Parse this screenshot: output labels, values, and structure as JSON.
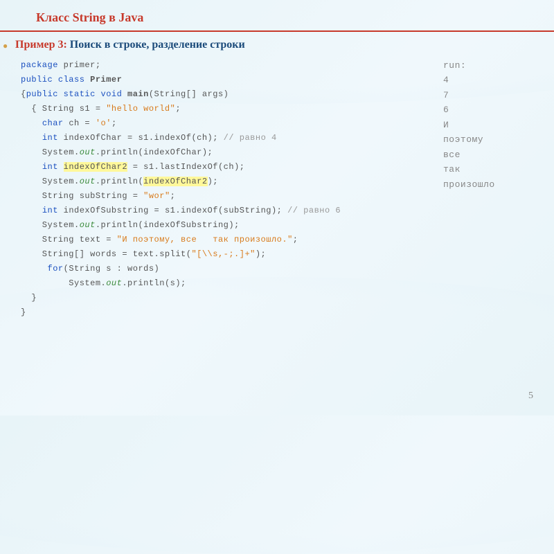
{
  "title": "Класс  String в Java",
  "subtitle_ex": "Пример 3:",
  "subtitle_desc": " Поиск в строке, разделение строки",
  "code": {
    "l1_a": "package",
    "l1_b": " primer;",
    "l2_a": "public class ",
    "l2_b": "Primer",
    "l3_a": "{",
    "l3_b": "public static void ",
    "l3_c": "main",
    "l3_d": "(String[] args)",
    "l4_a": "  { String s1 = ",
    "l4_b": "\"hello world\"",
    "l4_c": ";",
    "l5_a": "    ",
    "l5_b": "char",
    "l5_c": " ch = ",
    "l5_d": "'o'",
    "l5_e": ";",
    "l6_a": "    ",
    "l6_b": "int",
    "l6_c": " indexOfChar = s1.indexOf(ch); ",
    "l6_d": "// равно 4",
    "l7_a": "    System.",
    "l7_b": "out",
    "l7_c": ".println(indexOfChar);",
    "l8_a": "    ",
    "l8_b": "int",
    "l8_c": " ",
    "l8_d": "indexOfChar2",
    "l8_e": " = s1.lastIndexOf(ch);",
    "l9_a": "    System.",
    "l9_b": "out",
    "l9_c": ".println(",
    "l9_d": "indexOfChar2",
    "l9_e": ");",
    "l10_a": "    String subString = ",
    "l10_b": "\"wor\"",
    "l10_c": ";",
    "l11_a": "    ",
    "l11_b": "int",
    "l11_c": " indexOfSubstring = s1.indexOf(subString); ",
    "l11_d": "// равно 6",
    "l12_a": "    System.",
    "l12_b": "out",
    "l12_c": ".println(indexOfSubstring);",
    "l13_a": "    String text = ",
    "l13_b": "\"И поэтому, все   так произошло.\"",
    "l13_c": ";",
    "l14_a": "    String[] words = text.split(",
    "l14_b": "\"[\\\\s,-;.]+\"",
    "l14_c": ");",
    "l15_a": "     ",
    "l15_b": "for",
    "l15_c": "(String s : words)",
    "l16_a": "         System.",
    "l16_b": "out",
    "l16_c": ".println(s);",
    "l17": "  }",
    "l18": "}"
  },
  "output": {
    "run": "run:",
    "v1": "4",
    "v2": "7",
    "v3": "6",
    "w1": "И",
    "w2": "поэтому",
    "w3": "все",
    "w4": "так",
    "w5": "произошло"
  },
  "page_number": "5"
}
